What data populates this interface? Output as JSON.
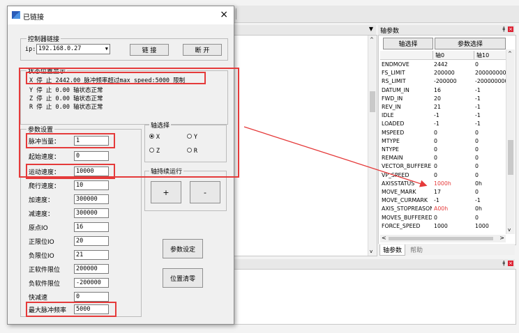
{
  "ide": {
    "axis_panel_title": "轴参数",
    "axis_select_btn": "轴选择",
    "param_select_btn": "参数选择",
    "table_header": [
      "",
      "轴0",
      "轴10"
    ],
    "rows": [
      {
        "name": "ENDMOVE",
        "v0": "2442",
        "v1": "0"
      },
      {
        "name": "FS_LIMIT",
        "v0": "200000",
        "v1": "200000000"
      },
      {
        "name": "RS_LIMIT",
        "v0": "-200000",
        "v1": "-200000000"
      },
      {
        "name": "DATUM_IN",
        "v0": "16",
        "v1": "-1"
      },
      {
        "name": "FWD_IN",
        "v0": "20",
        "v1": "-1"
      },
      {
        "name": "REV_IN",
        "v0": "21",
        "v1": "-1"
      },
      {
        "name": "IDLE",
        "v0": "-1",
        "v1": "-1"
      },
      {
        "name": "LOADED",
        "v0": "-1",
        "v1": "-1"
      },
      {
        "name": "MSPEED",
        "v0": "0",
        "v1": "0"
      },
      {
        "name": "MTYPE",
        "v0": "0",
        "v1": "0"
      },
      {
        "name": "NTYPE",
        "v0": "0",
        "v1": "0"
      },
      {
        "name": "REMAIN",
        "v0": "0",
        "v1": "0"
      },
      {
        "name": "VECTOR_BUFFERED",
        "v0": "0",
        "v1": "0"
      },
      {
        "name": "VP_SPEED",
        "v0": "0",
        "v1": "0"
      },
      {
        "name": "AXISSTATUS",
        "v0": "1000h",
        "v1": "0h"
      },
      {
        "name": "MOVE_MARK",
        "v0": "17",
        "v1": "0"
      },
      {
        "name": "MOVE_CURMARK",
        "v0": "-1",
        "v1": "-1"
      },
      {
        "name": "AXIS_STOPREASON",
        "v0": "A00h",
        "v1": "0h"
      },
      {
        "name": "MOVES_BUFFERED",
        "v0": "0",
        "v1": "0"
      },
      {
        "name": "FORCE_SPEED",
        "v0": "1000",
        "v1": "1000"
      }
    ],
    "tab_axis": "轴参数",
    "tab_help": "帮助",
    "colors": {
      "red_value": "#e53a3a",
      "annot": "#e53a3a"
    }
  },
  "dialog": {
    "title": "已链接",
    "close_glyph": "×",
    "conn_group": "控制器链接",
    "ip_label": "ip:",
    "ip_value": "192.168.0.27",
    "link_btn": "链 接",
    "disconnect_btn": "断 开",
    "status_group": "状态位置显示",
    "status_lines": [
      "X  停  止  2442.00   脉冲频率超过max_speed:5000 限制",
      "Y  停  止  0.00   轴状态正常",
      "Z  停  止  0.00   轴状态正常",
      "R  停  止  0.00   轴状态正常"
    ],
    "param_group": "参数设置",
    "params": [
      {
        "label": "脉冲当量：",
        "value": "1"
      },
      {
        "label": "起始速度：",
        "value": "0"
      },
      {
        "label": "运动速度：",
        "value": "10000"
      },
      {
        "label": "爬行速度：",
        "value": "10"
      },
      {
        "label": "加速度：",
        "value": "300000"
      },
      {
        "label": "减速度：",
        "value": "300000"
      },
      {
        "label": "原点IO",
        "value": "16"
      },
      {
        "label": "正限位IO",
        "value": "20"
      },
      {
        "label": "负限位IO",
        "value": "21"
      },
      {
        "label": "正软件限位",
        "value": "200000"
      },
      {
        "label": "负软件限位",
        "value": "-200000"
      },
      {
        "label": "快减速",
        "value": "0"
      },
      {
        "label": "最大脉冲频率",
        "value": "5000"
      }
    ],
    "axis_group": "轴选择",
    "axes": [
      "X",
      "Y",
      "Z",
      "R"
    ],
    "jog_group": "轴持续运行",
    "jog_plus": "+",
    "jog_minus": "-",
    "set_params_btn": "参数设定",
    "clear_pos_btn": "位置清零"
  }
}
